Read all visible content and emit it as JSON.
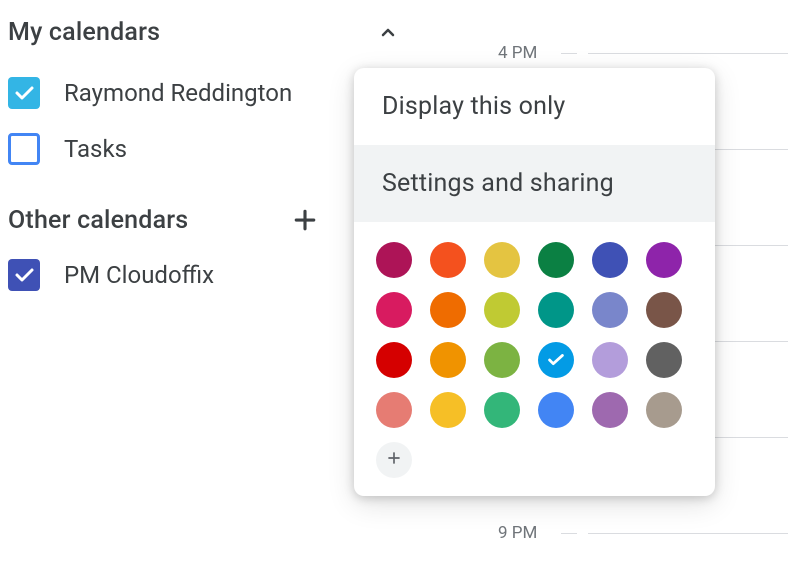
{
  "sidebar": {
    "my_calendars": {
      "title": "My calendars",
      "items": [
        {
          "label": "Raymond Reddington",
          "checked": true,
          "color": "#33b5e5"
        },
        {
          "label": "Tasks",
          "checked": false,
          "color": "#4285f4"
        }
      ]
    },
    "other_calendars": {
      "title": "Other calendars",
      "items": [
        {
          "label": "PM Cloudoffix",
          "checked": true,
          "color": "#3f51b5"
        }
      ]
    }
  },
  "timegrid": {
    "labels": [
      "4 PM",
      "9 PM"
    ]
  },
  "popover": {
    "display_only": "Display this only",
    "settings_sharing": "Settings and sharing",
    "colors": [
      "#ad1457",
      "#f4511e",
      "#e4c441",
      "#0b8043",
      "#3f51b5",
      "#8e24aa",
      "#d81b60",
      "#ef6c00",
      "#c0ca33",
      "#009688",
      "#7986cb",
      "#795548",
      "#d50000",
      "#f09300",
      "#7cb342",
      "#039be5",
      "#b39ddb",
      "#616161",
      "#e67c73",
      "#f6bf26",
      "#33b679",
      "#4285f4",
      "#9e69af",
      "#a79b8e"
    ],
    "selected_color_index": 15
  }
}
